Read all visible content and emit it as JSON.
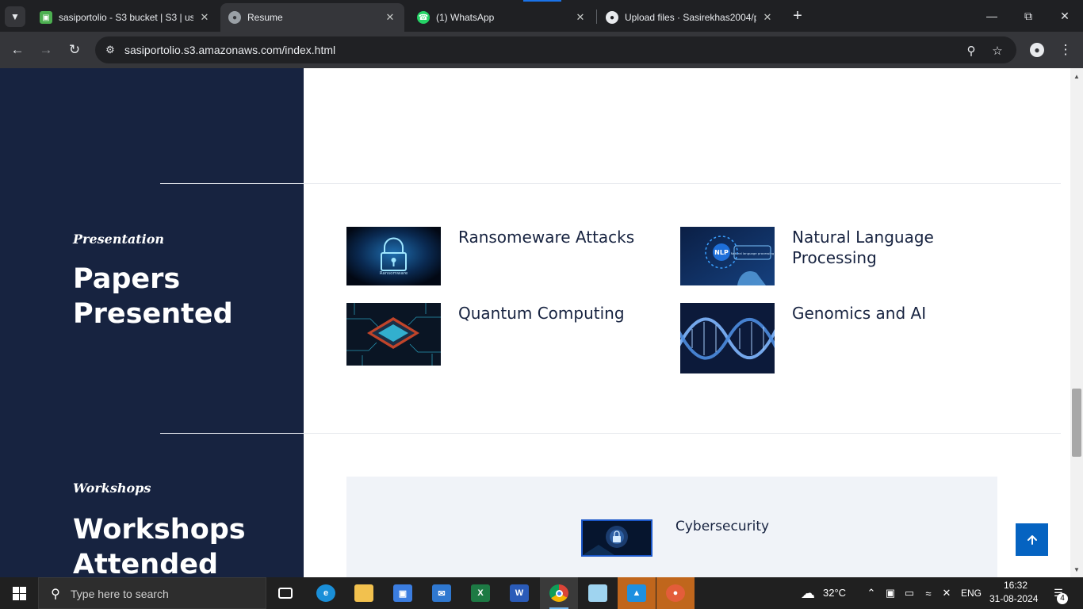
{
  "browser": {
    "tabs": [
      {
        "title": "sasiportolio - S3 bucket | S3 | us",
        "active": false
      },
      {
        "title": "Resume",
        "active": true
      },
      {
        "title": "(1) WhatsApp",
        "active": false
      },
      {
        "title": "Upload files · Sasirekhas2004/po",
        "active": false
      }
    ],
    "url": "sasiportolio.s3.amazonaws.com/index.html"
  },
  "page": {
    "peek_text": "",
    "papers": {
      "subtitle": "Presentation",
      "heading": "Papers Presented",
      "items": [
        {
          "title": "Ransomeware Attacks",
          "thumb": "ransomware-lock"
        },
        {
          "title": "Natural Language Processing",
          "thumb": "nlp-hand"
        },
        {
          "title": "Quantum Computing",
          "thumb": "quantum-chip"
        },
        {
          "title": "Genomics and AI",
          "thumb": "dna-helix"
        }
      ]
    },
    "workshops": {
      "subtitle": "Workshops",
      "heading": "Workshops Attended",
      "items": [
        {
          "title": "Cybersecurity",
          "thumb": "cyber-lock"
        }
      ]
    },
    "thumb_labels": {
      "ransomware": "Ransomware",
      "nlp_badge": "NLP",
      "nlp_caption": "Natural language processing"
    }
  },
  "taskbar": {
    "search_placeholder": "Type here to search",
    "weather": "32°C",
    "language": "ENG",
    "time": "16:32",
    "date": "31-08-2024",
    "notification_count": "4"
  }
}
